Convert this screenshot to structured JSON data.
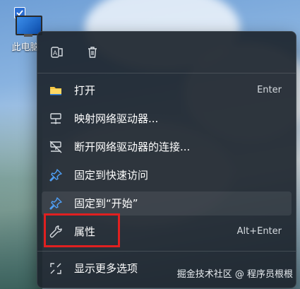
{
  "desktop": {
    "icon_label": "此电脑"
  },
  "menu": {
    "top_icons": [
      "translate-icon",
      "trash-icon"
    ],
    "items": [
      {
        "label": "打开",
        "shortcut": "Enter",
        "icon": "folder-icon"
      },
      {
        "label": "映射网络驱动器...",
        "shortcut": "",
        "icon": "network-drive-icon"
      },
      {
        "label": "断开网络驱动器的连接...",
        "shortcut": "",
        "icon": "disconnect-drive-icon"
      },
      {
        "label": "固定到快速访问",
        "shortcut": "",
        "icon": "pin-icon"
      },
      {
        "label": "固定到“开始”",
        "shortcut": "",
        "icon": "pin-icon"
      },
      {
        "label": "属性",
        "shortcut": "Alt+Enter",
        "icon": "wrench-icon"
      },
      {
        "label": "显示更多选项",
        "shortcut": "",
        "icon": "expand-icon"
      }
    ]
  },
  "watermark": "掘金技术社区 @ 程序员根根",
  "colors": {
    "menu_bg": "#1c242c",
    "pin_blue": "#4f9ff5",
    "folder_yellow": "#f5c542",
    "highlight_red": "#e02020"
  }
}
